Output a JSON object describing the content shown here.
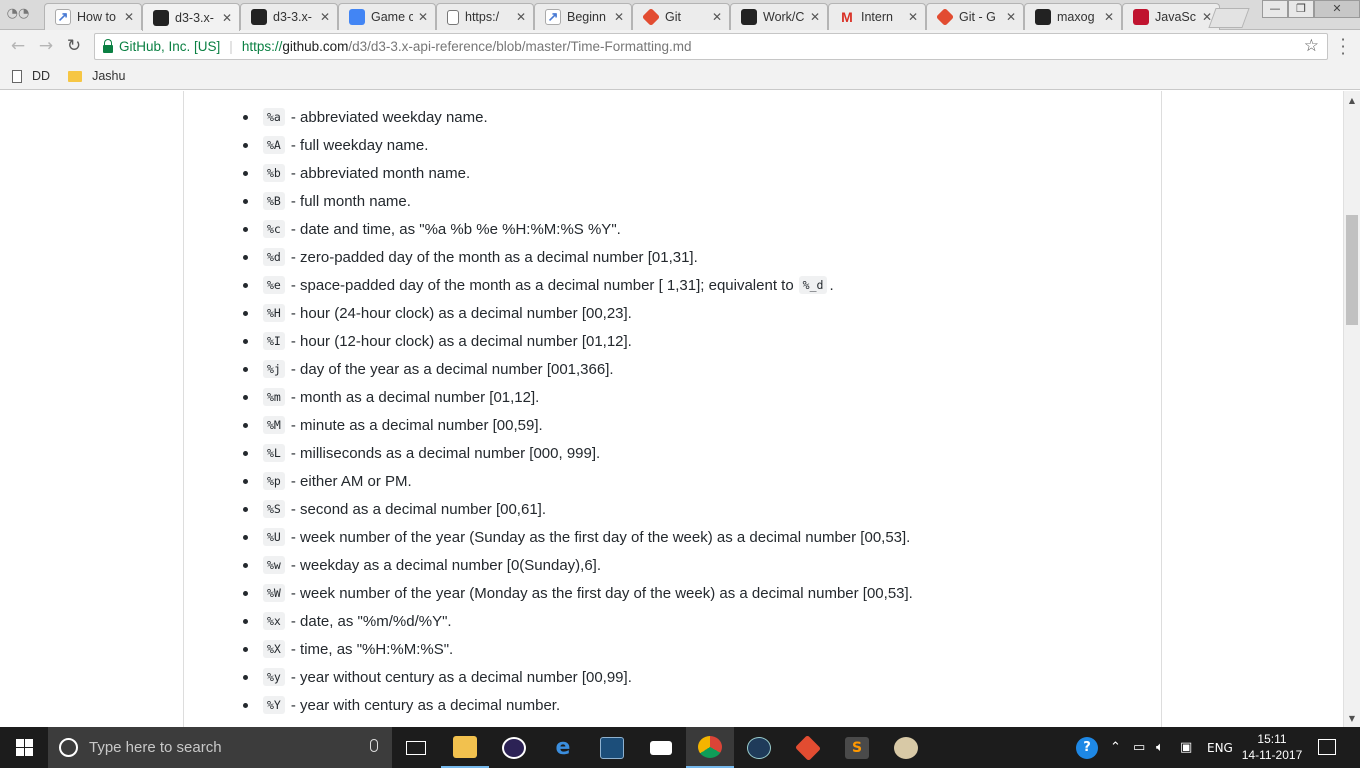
{
  "browser": {
    "tabs": [
      {
        "title": "How to",
        "favicon": "chart-favicon"
      },
      {
        "title": "d3-3.x-",
        "favicon": "github-favicon",
        "active": true
      },
      {
        "title": "d3-3.x-",
        "favicon": "github-favicon"
      },
      {
        "title": "Game c",
        "favicon": "game-favicon"
      },
      {
        "title": "https:/",
        "favicon": "document-favicon"
      },
      {
        "title": "Beginn",
        "favicon": "chart-favicon"
      },
      {
        "title": "Git",
        "favicon": "git-favicon"
      },
      {
        "title": "Work/C",
        "favicon": "github-favicon"
      },
      {
        "title": "Intern",
        "favicon": "gmail-favicon"
      },
      {
        "title": "Git - G",
        "favicon": "git-favicon"
      },
      {
        "title": "maxog",
        "favicon": "github-favicon"
      },
      {
        "title": "JavaSc",
        "favicon": "js-favicon"
      }
    ],
    "close_glyph": "✕",
    "url": {
      "security_label": "GitHub, Inc. [US]",
      "scheme": "https://",
      "host": "github.com",
      "path": "/d3/d3-3.x-api-reference/blob/master/Time-Formatting.md"
    },
    "bookmarks": [
      {
        "label": "DD",
        "icon": "page-icon"
      },
      {
        "label": "Jashu",
        "icon": "folder-icon"
      }
    ]
  },
  "doc": {
    "items": [
      {
        "code": "%a",
        "text": "- abbreviated weekday name."
      },
      {
        "code": "%A",
        "text": "- full weekday name."
      },
      {
        "code": "%b",
        "text": "- abbreviated month name."
      },
      {
        "code": "%B",
        "text": "- full month name."
      },
      {
        "code": "%c",
        "text": "- date and time, as \"%a %b %e %H:%M:%S %Y\"."
      },
      {
        "code": "%d",
        "text": "- zero-padded day of the month as a decimal number [01,31]."
      },
      {
        "code": "%e",
        "text": "- space-padded day of the month as a decimal number [ 1,31]; equivalent to",
        "tail_code": "%_d",
        "tail": "."
      },
      {
        "code": "%H",
        "text": "- hour (24-hour clock) as a decimal number [00,23]."
      },
      {
        "code": "%I",
        "text": "- hour (12-hour clock) as a decimal number [01,12]."
      },
      {
        "code": "%j",
        "text": "- day of the year as a decimal number [001,366]."
      },
      {
        "code": "%m",
        "text": "- month as a decimal number [01,12]."
      },
      {
        "code": "%M",
        "text": "- minute as a decimal number [00,59]."
      },
      {
        "code": "%L",
        "text": "- milliseconds as a decimal number [000, 999]."
      },
      {
        "code": "%p",
        "text": "- either AM or PM."
      },
      {
        "code": "%S",
        "text": "- second as a decimal number [00,61]."
      },
      {
        "code": "%U",
        "text": "- week number of the year (Sunday as the first day of the week) as a decimal number [00,53]."
      },
      {
        "code": "%w",
        "text": "- weekday as a decimal number [0(Sunday),6]."
      },
      {
        "code": "%W",
        "text": "- week number of the year (Monday as the first day of the week) as a decimal number [00,53]."
      },
      {
        "code": "%x",
        "text": "- date, as \"%m/%d/%Y\"."
      },
      {
        "code": "%X",
        "text": "- time, as \"%H:%M:%S\"."
      },
      {
        "code": "%y",
        "text": "- year without century as a decimal number [00,99]."
      },
      {
        "code": "%Y",
        "text": "- year with century as a decimal number."
      }
    ]
  },
  "taskbar": {
    "search_placeholder": "Type here to search",
    "apps": [
      "task-view-icon",
      "file-explorer-icon",
      "eclipse-icon",
      "edge-icon",
      "mysql-workbench-icon",
      "mail-icon",
      "chrome-icon",
      "app-icon",
      "git-gui-icon",
      "sublime-text-icon",
      "paint-icon"
    ],
    "language": "ENG",
    "time": "15:11",
    "date": "14-11-2017"
  },
  "colors": {
    "secure_green": "#0b8043",
    "taskbar_bg": "#1c1c1c",
    "accent_blue": "#76b9ed"
  }
}
